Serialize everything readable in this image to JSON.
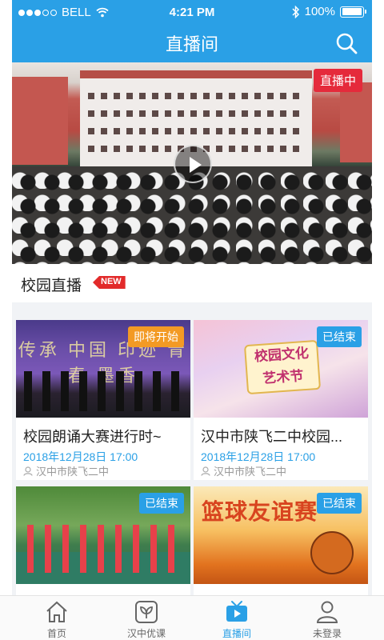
{
  "status_bar": {
    "carrier": "BELL",
    "time": "4:21 PM",
    "battery": "100%"
  },
  "header": {
    "title": "直播间"
  },
  "hero": {
    "live_badge": "直播中"
  },
  "section": {
    "title": "校园直播",
    "new_badge": "NEW"
  },
  "cards": [
    {
      "badge": "即将开始",
      "title": "校园朗诵大赛进行时~",
      "time": "2018年12月28日 17:00",
      "location": "汉中市陕飞二中",
      "poster_text": "传承 中国 印迹 青春 墨香"
    },
    {
      "badge": "已结束",
      "title": "汉中市陕飞二中校园...",
      "time": "2018年12月28日 17:00",
      "location": "汉中市陕飞二中",
      "poster_text": "校园文化 艺术节"
    },
    {
      "badge": "已结束",
      "title": "",
      "time": "",
      "location": ""
    },
    {
      "badge": "已结束",
      "title": "",
      "time": "",
      "location": "",
      "poster_text": "篮球友谊赛"
    }
  ],
  "tabs": [
    {
      "label": "首页",
      "icon": "home-icon"
    },
    {
      "label": "汉中优课",
      "icon": "leaf-icon"
    },
    {
      "label": "直播间",
      "icon": "tv-icon"
    },
    {
      "label": "未登录",
      "icon": "user-icon"
    }
  ],
  "colors": {
    "primary": "#2aa0e6",
    "live_red": "#e52a3b",
    "upcoming_orange": "#f39a24"
  }
}
